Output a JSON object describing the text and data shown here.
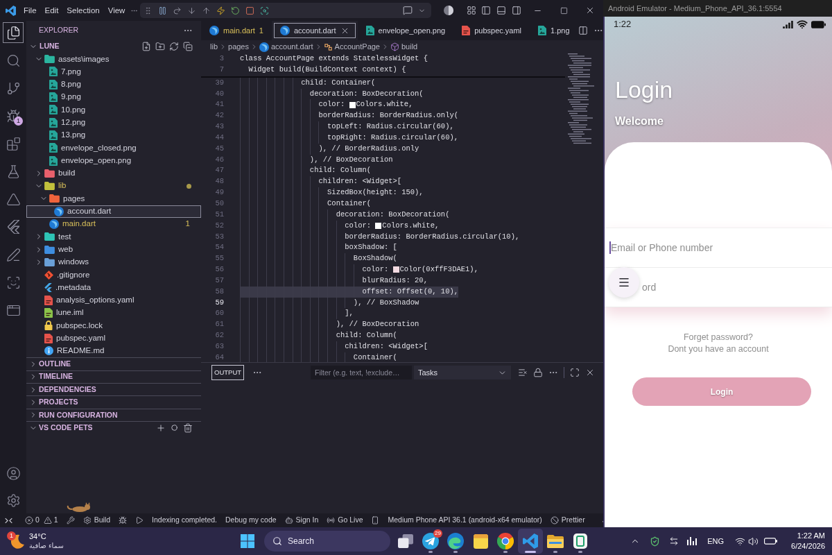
{
  "vscode": {
    "menu": [
      "File",
      "Edit",
      "Selection",
      "View"
    ],
    "activity_bar": [
      {
        "kind": "explorer",
        "selected": true
      },
      {
        "kind": "search",
        "selected": false
      },
      {
        "kind": "source-control",
        "selected": false
      },
      {
        "kind": "run-debug",
        "selected": false,
        "badge": "1"
      },
      {
        "kind": "extensions",
        "selected": false
      },
      {
        "kind": "testing",
        "selected": false
      },
      {
        "kind": "triangle",
        "selected": false
      },
      {
        "kind": "flutter",
        "selected": false
      },
      {
        "kind": "pen",
        "selected": false
      },
      {
        "kind": "scan",
        "selected": false
      },
      {
        "kind": "preview",
        "selected": false
      }
    ],
    "sidebar": {
      "title": "EXPLORER",
      "root": {
        "label": "LUNE",
        "expanded": true,
        "children": [
          {
            "label": "assets\\images",
            "kind": "folder",
            "color": "#2bb5a0",
            "expanded": true,
            "selected": false,
            "warning": false,
            "children": [
              {
                "label": "7.png",
                "kind": "image",
                "selected": false,
                "warning": false
              },
              {
                "label": "8.png",
                "kind": "image",
                "selected": false,
                "warning": false
              },
              {
                "label": "9.png",
                "kind": "image",
                "selected": false,
                "warning": false
              },
              {
                "label": "10.png",
                "kind": "image",
                "selected": false,
                "warning": false
              },
              {
                "label": "12.png",
                "kind": "image",
                "selected": false,
                "warning": false
              },
              {
                "label": "13.png",
                "kind": "image",
                "selected": false,
                "warning": false
              },
              {
                "label": "envelope_closed.png",
                "kind": "image",
                "selected": false,
                "warning": false
              },
              {
                "label": "envelope_open.png",
                "kind": "image",
                "selected": false,
                "warning": false
              }
            ]
          },
          {
            "label": "build",
            "kind": "folder",
            "color": "#e8606c",
            "expanded": false,
            "selected": false,
            "warning": false
          },
          {
            "label": "lib",
            "kind": "folder",
            "color": "#c2c13c",
            "expanded": true,
            "selected": false,
            "warning": true,
            "children": [
              {
                "label": "pages",
                "kind": "folder",
                "color": "#f0643c",
                "expanded": true,
                "selected": false,
                "warning": false,
                "children": [
                  {
                    "label": "account.dart",
                    "kind": "dart",
                    "selected": true,
                    "warning": false
                  }
                ]
              },
              {
                "label": "main.dart",
                "kind": "dart",
                "selected": false,
                "warning": true,
                "badge": "1"
              }
            ]
          },
          {
            "label": "test",
            "kind": "folder",
            "color": "#2ec4b6",
            "expanded": false,
            "selected": false,
            "warning": false
          },
          {
            "label": "web",
            "kind": "folder",
            "color": "#3e8ee0",
            "expanded": false,
            "selected": false,
            "warning": false
          },
          {
            "label": "windows",
            "kind": "folder",
            "color": "#6aa0d8",
            "expanded": false,
            "selected": false,
            "warning": false
          },
          {
            "label": ".gitignore",
            "kind": "git",
            "selected": false,
            "warning": false
          },
          {
            "label": ".metadata",
            "kind": "flutter",
            "selected": false,
            "warning": false
          },
          {
            "label": "analysis_options.yaml",
            "kind": "yaml",
            "selected": false,
            "warning": false
          },
          {
            "label": "lune.iml",
            "kind": "iml",
            "selected": false,
            "warning": false
          },
          {
            "label": "pubspec.lock",
            "kind": "lock",
            "selected": false,
            "warning": false
          },
          {
            "label": "pubspec.yaml",
            "kind": "yaml",
            "selected": false,
            "warning": false
          },
          {
            "label": "README.md",
            "kind": "info",
            "selected": false,
            "warning": false
          }
        ]
      },
      "sections": [
        {
          "label": "OUTLINE",
          "expanded": false
        },
        {
          "label": "TIMELINE",
          "expanded": false
        },
        {
          "label": "DEPENDENCIES",
          "expanded": false
        },
        {
          "label": "PROJECTS",
          "expanded": false
        },
        {
          "label": "RUN CONFIGURATION",
          "expanded": false
        },
        {
          "label": "VS CODE PETS",
          "expanded": true
        }
      ]
    },
    "tabs": [
      {
        "label": "main.dart",
        "kind": "dart",
        "selected": false,
        "warning": true,
        "badge": "1"
      },
      {
        "label": "account.dart",
        "kind": "dart",
        "selected": true,
        "warning": false
      },
      {
        "label": "envelope_open.png",
        "kind": "image",
        "selected": false,
        "warning": false
      },
      {
        "label": "pubspec.yaml",
        "kind": "yaml",
        "selected": false,
        "warning": false
      },
      {
        "label": "1.png",
        "kind": "image",
        "selected": false,
        "warning": false
      }
    ],
    "breadcrumbs": [
      {
        "label": "lib",
        "kind": "folder"
      },
      {
        "label": "pages",
        "kind": "folder"
      },
      {
        "label": "account.dart",
        "kind": "dart"
      },
      {
        "label": "AccountPage",
        "kind": "class"
      },
      {
        "label": "build",
        "kind": "method"
      }
    ],
    "sticky_lines": [
      {
        "number": "3",
        "code": "class AccountPage extends StatelessWidget {"
      },
      {
        "number": "7",
        "code": "  Widget build(BuildContext context) {"
      }
    ],
    "lines": [
      {
        "number": "39",
        "code": "              child: Container(",
        "current": false,
        "selected": false
      },
      {
        "number": "40",
        "code": "                decoration: BoxDecoration(",
        "current": false,
        "selected": false
      },
      {
        "number": "41",
        "code": "                  color: ",
        "color": "#ffffff",
        "code_after": "Colors.white,",
        "current": false,
        "selected": false
      },
      {
        "number": "42",
        "code": "                  borderRadius: BorderRadius.only(",
        "current": false,
        "selected": false
      },
      {
        "number": "43",
        "code": "                    topLeft: Radius.circular(60),",
        "current": false,
        "selected": false
      },
      {
        "number": "44",
        "code": "                    topRight: Radius.circular(60),",
        "current": false,
        "selected": false
      },
      {
        "number": "45",
        "code": "                  ), // BorderRadius.only",
        "current": false,
        "selected": false
      },
      {
        "number": "46",
        "code": "                ), // BoxDecoration",
        "current": false,
        "selected": false
      },
      {
        "number": "47",
        "code": "                child: Column(",
        "current": false,
        "selected": false
      },
      {
        "number": "48",
        "code": "                  children: <Widget>[",
        "current": false,
        "selected": false
      },
      {
        "number": "49",
        "code": "                    SizedBox(height: 150),",
        "current": false,
        "selected": false
      },
      {
        "number": "50",
        "code": "                    Container(",
        "current": false,
        "selected": false
      },
      {
        "number": "51",
        "code": "                      decoration: BoxDecoration(",
        "current": false,
        "selected": false
      },
      {
        "number": "52",
        "code": "                        color: ",
        "color": "#ffffff",
        "code_after": "Colors.white,",
        "current": false,
        "selected": false
      },
      {
        "number": "53",
        "code": "                        borderRadius: BorderRadius.circular(10),",
        "current": false,
        "selected": false
      },
      {
        "number": "54",
        "code": "                        boxShadow: [",
        "current": false,
        "selected": false
      },
      {
        "number": "55",
        "code": "                          BoxShadow(",
        "current": false,
        "selected": false
      },
      {
        "number": "56",
        "code": "                            color: ",
        "color": "#f3dae1",
        "code_after": "Color(0xffF3DAE1),",
        "current": false,
        "selected": false
      },
      {
        "number": "57",
        "code": "                            blurRadius: 20,",
        "current": false,
        "selected": false
      },
      {
        "number": "58",
        "code": "                            offset: Offset(0, 10),",
        "current": false,
        "selected": true
      },
      {
        "number": "59",
        "code": "                          ), // BoxShadow",
        "current": true,
        "selected": false
      },
      {
        "number": "60",
        "code": "                        ],",
        "current": false,
        "selected": false
      },
      {
        "number": "61",
        "code": "                      ), // BoxDecoration",
        "current": false,
        "selected": false
      },
      {
        "number": "62",
        "code": "                      child: Column(",
        "current": false,
        "selected": false
      },
      {
        "number": "63",
        "code": "                        children: <Widget>[",
        "current": false,
        "selected": false
      },
      {
        "number": "64",
        "code": "                          Container(",
        "current": false,
        "selected": false
      }
    ],
    "panel": {
      "tabs": [
        {
          "label": "OUTPUT",
          "selected": true
        }
      ],
      "filter": {
        "placeholder": "Filter (e.g. text, !exclude…"
      },
      "dropdown": {
        "value": "Tasks"
      }
    },
    "status_bar": {
      "errors": "0",
      "warnings": "1",
      "build": "Build",
      "indexing": "Indexing completed.",
      "debug_my_code": "Debug my code",
      "sign_in": "Sign In",
      "go_live": "Go Live",
      "device": "Medium Phone API 36.1 (android-x64 emulator)",
      "prettier": "Prettier"
    }
  },
  "emulator": {
    "title": "Android Emulator - Medium_Phone_API_36.1:5554",
    "phone": {
      "time": "1:22",
      "title": "Login",
      "subtitle": "Welcome",
      "fields": [
        {
          "placeholder": "Email or Phone number",
          "focused": true
        },
        {
          "placeholder": "ord",
          "focused": false
        }
      ],
      "forgot_password": "Forget password?",
      "signup_prompt": "Dont you have an account",
      "button": "Login"
    }
  },
  "taskbar": {
    "weather": {
      "badge": "1",
      "temperature": "34°C",
      "condition": "سماء صافية"
    },
    "search": {
      "placeholder": "Search"
    },
    "apps": [
      {
        "kind": "task-view",
        "selected": false,
        "running": false
      },
      {
        "kind": "paper-plane",
        "selected": false,
        "running": true,
        "badge": "29"
      },
      {
        "kind": "swirl",
        "selected": false,
        "running": true
      },
      {
        "kind": "notes",
        "selected": false,
        "running": false
      },
      {
        "kind": "ring",
        "selected": false,
        "running": true
      },
      {
        "kind": "code",
        "selected": true,
        "running": true
      },
      {
        "kind": "folder",
        "selected": false,
        "running": true
      },
      {
        "kind": "phone",
        "selected": false,
        "running": true
      }
    ],
    "tray": {
      "language": "ENG",
      "time": "1:22 AM",
      "date": "6/24/2026"
    }
  }
}
